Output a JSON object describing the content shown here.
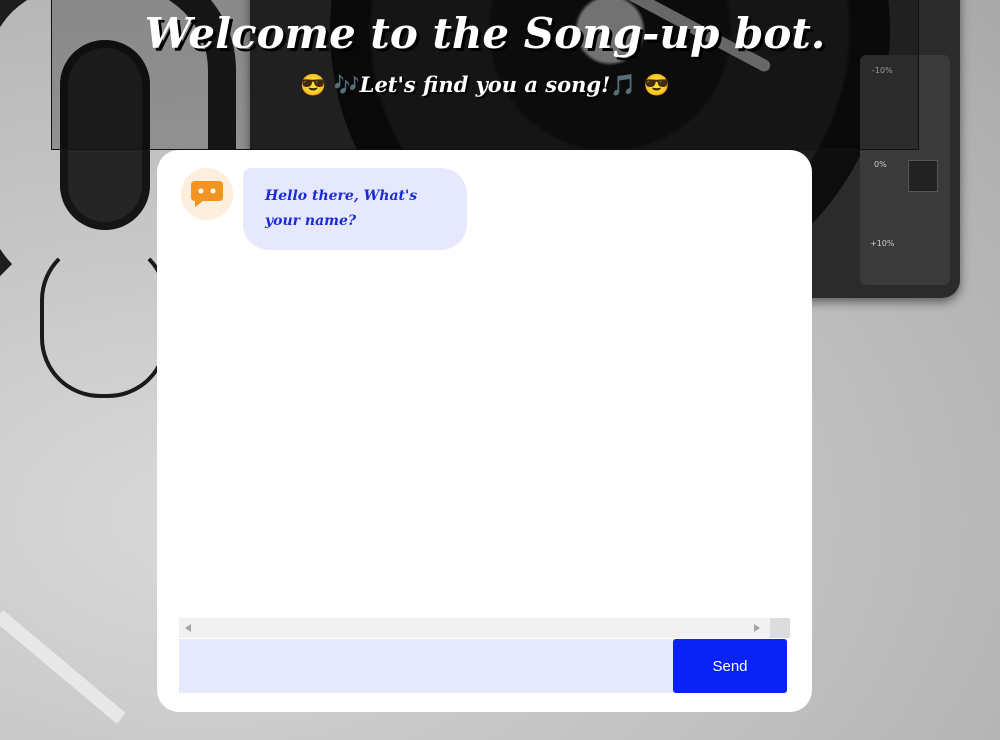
{
  "header": {
    "title": "Welcome to the Song-up bot.",
    "subtitle_text": "Let's find you a song!",
    "subtitle_emoji_left": "😎 🎶",
    "subtitle_emoji_right": "🎵 😎"
  },
  "background": {
    "pitch_labels": [
      "-10%",
      "0%",
      "+10%"
    ]
  },
  "chat": {
    "messages": [
      {
        "sender": "bot",
        "avatar_icon": "chat-bubble-icon",
        "text": "Hello there, What's your name?"
      }
    ],
    "input": {
      "value": "",
      "placeholder": ""
    },
    "send_label": "Send"
  },
  "colors": {
    "bubble_bg": "#e6e9fd",
    "bubble_text": "#1b2bd6",
    "send_button": "#0a22f5",
    "avatar_bg": "#fdeedd",
    "avatar_icon": "#f39322"
  }
}
